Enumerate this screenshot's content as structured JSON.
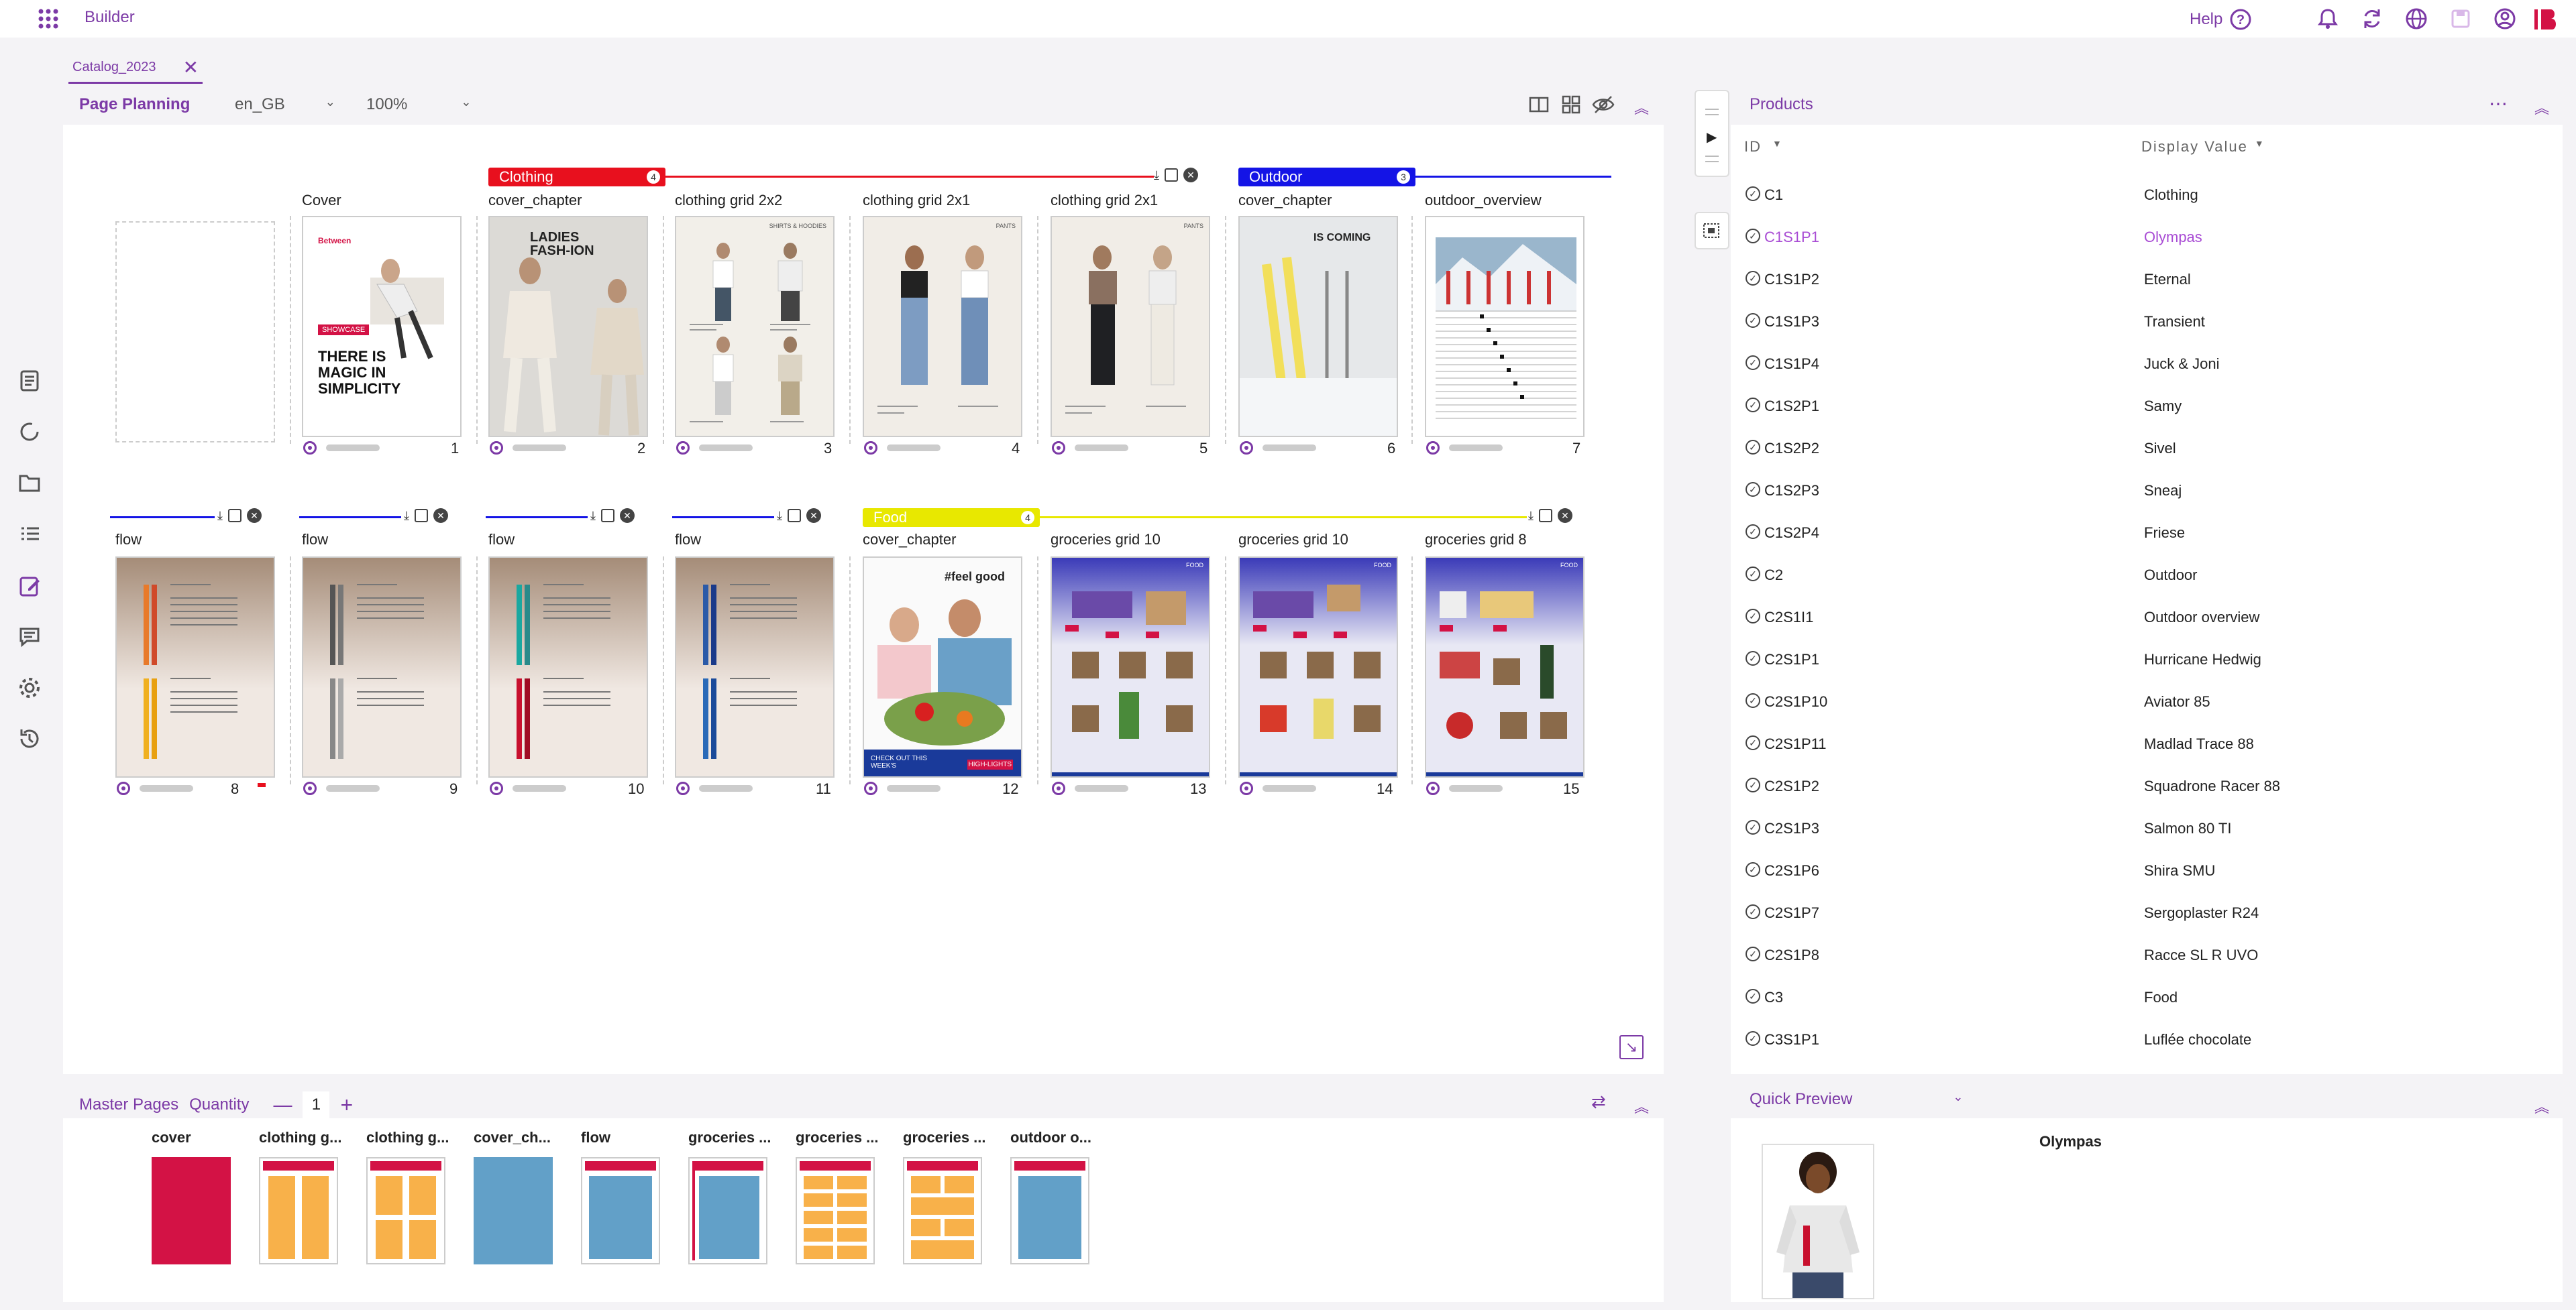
{
  "app": {
    "title": "Builder",
    "help_label": "Help"
  },
  "tab": {
    "label": "Catalog_2023"
  },
  "planning": {
    "title": "Page Planning",
    "locale": "en_GB",
    "zoom": "100%"
  },
  "chapters": [
    {
      "name": "Clothing",
      "count": "4",
      "color": "#e8101e"
    },
    {
      "name": "Outdoor",
      "count": "3",
      "color": "#1414e6"
    },
    {
      "name": "Food",
      "count": "4",
      "color": "#e8e800"
    }
  ],
  "pages": [
    {
      "label": "Cover",
      "num": "1"
    },
    {
      "label": "cover_chapter",
      "num": "2"
    },
    {
      "label": "clothing grid 2x2",
      "num": "3"
    },
    {
      "label": "clothing grid 2x1",
      "num": "4"
    },
    {
      "label": "clothing grid 2x1",
      "num": "5"
    },
    {
      "label": "cover_chapter",
      "num": "6"
    },
    {
      "label": "outdoor_overview",
      "num": "7"
    },
    {
      "label": "flow",
      "num": "8"
    },
    {
      "label": "flow",
      "num": "9"
    },
    {
      "label": "flow",
      "num": "10"
    },
    {
      "label": "flow",
      "num": "11"
    },
    {
      "label": "cover_chapter",
      "num": "12"
    },
    {
      "label": "groceries grid 10",
      "num": "13"
    },
    {
      "label": "groceries grid 10",
      "num": "14"
    },
    {
      "label": "groceries grid 8",
      "num": "15"
    }
  ],
  "page_text": {
    "cover_brand": "Between",
    "cover_tag": "SHOWCASE",
    "cover_headline": "THERE IS MAGIC IN SIMPLICITY",
    "ladies": "LADIES FASH-ION",
    "shirts": "SHIRTS & HOODIES",
    "pants": "PANTS",
    "coming": "IS COMING",
    "food_head": "#feel good",
    "food_foot": "CHECK OUT THIS WEEK'S",
    "food_badge": "HIGH-LIGHTS",
    "food_tag": "FOOD"
  },
  "master": {
    "title": "Master Pages",
    "quantity_label": "Quantity",
    "quantity_value": "1",
    "items": [
      {
        "label": "cover"
      },
      {
        "label": "clothing g..."
      },
      {
        "label": "clothing g..."
      },
      {
        "label": "cover_ch..."
      },
      {
        "label": "flow"
      },
      {
        "label": "groceries ..."
      },
      {
        "label": "groceries ..."
      },
      {
        "label": "groceries ..."
      },
      {
        "label": "outdoor o..."
      }
    ]
  },
  "products": {
    "title": "Products",
    "col_id": "ID",
    "col_value": "Display Value",
    "rows": [
      {
        "id": "C1",
        "value": "Clothing"
      },
      {
        "id": "C1S1P1",
        "value": "Olympas",
        "selected": true
      },
      {
        "id": "C1S1P2",
        "value": "Eternal"
      },
      {
        "id": "C1S1P3",
        "value": "Transient"
      },
      {
        "id": "C1S1P4",
        "value": "Juck & Joni"
      },
      {
        "id": "C1S2P1",
        "value": "Samy"
      },
      {
        "id": "C1S2P2",
        "value": "Sivel"
      },
      {
        "id": "C1S2P3",
        "value": "Sneaj"
      },
      {
        "id": "C1S2P4",
        "value": "Friese"
      },
      {
        "id": "C2",
        "value": "Outdoor"
      },
      {
        "id": "C2S1I1",
        "value": "Outdoor overview"
      },
      {
        "id": "C2S1P1",
        "value": "Hurricane Hedwig"
      },
      {
        "id": "C2S1P10",
        "value": "Aviator 85"
      },
      {
        "id": "C2S1P11",
        "value": "Madlad Trace 88"
      },
      {
        "id": "C2S1P2",
        "value": "Squadrone Racer 88"
      },
      {
        "id": "C2S1P3",
        "value": "Salmon 80 TI"
      },
      {
        "id": "C2S1P6",
        "value": "Shira SMU"
      },
      {
        "id": "C2S1P7",
        "value": "Sergoplaster R24"
      },
      {
        "id": "C2S1P8",
        "value": "Racce SL R UVO"
      },
      {
        "id": "C3",
        "value": "Food"
      },
      {
        "id": "C3S1P1",
        "value": "Luflée chocolate"
      }
    ]
  },
  "preview": {
    "title": "Quick Preview",
    "product_name": "Olympas"
  },
  "colors": {
    "accent": "#7c3aa6",
    "selected": "#a84bd4",
    "master_red": "#d31245",
    "master_orange": "#f8b14a",
    "master_blue": "#62a0c8"
  }
}
